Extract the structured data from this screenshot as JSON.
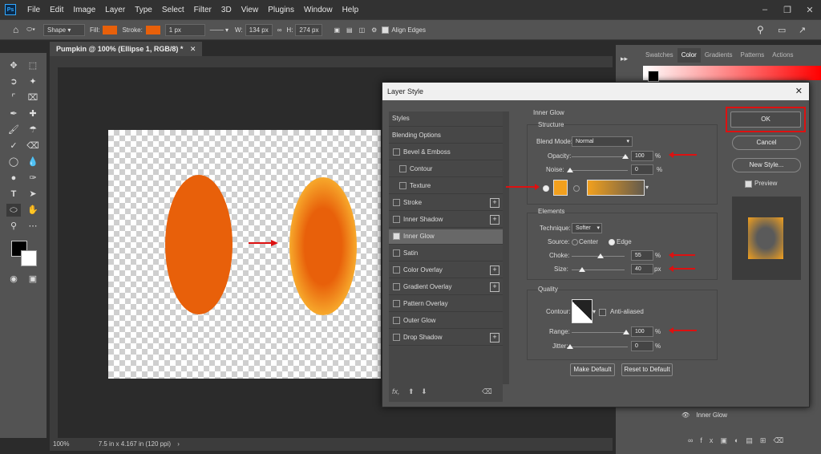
{
  "app": {
    "logo": "Ps"
  },
  "menu": [
    "File",
    "Edit",
    "Image",
    "Layer",
    "Type",
    "Select",
    "Filter",
    "3D",
    "View",
    "Plugins",
    "Window",
    "Help"
  ],
  "options": {
    "mode": "Shape",
    "fill_label": "Fill:",
    "stroke_label": "Stroke:",
    "stroke_width": "1 px",
    "w_label": "W:",
    "w_value": "134 px",
    "h_label": "H:",
    "h_value": "274 px",
    "align_edges": "Align Edges",
    "fill_color": "#e8600a"
  },
  "document": {
    "tab": "Pumpkin @ 100% (Ellipse 1, RGB/8) *",
    "zoom": "100%",
    "size": "7.5 in x 4.167 in (120 ppi)"
  },
  "panels": {
    "tabs": [
      "Swatches",
      "Color",
      "Gradients",
      "Patterns",
      "Actions"
    ],
    "active": "Color",
    "layer_effect": "Inner Glow"
  },
  "dialog": {
    "title": "Layer Style",
    "styles_header": "Styles",
    "items": [
      {
        "label": "Blending Options"
      },
      {
        "label": "Bevel & Emboss"
      },
      {
        "label": "Contour"
      },
      {
        "label": "Texture"
      },
      {
        "label": "Stroke"
      },
      {
        "label": "Inner Shadow"
      },
      {
        "label": "Inner Glow"
      },
      {
        "label": "Satin"
      },
      {
        "label": "Color Overlay"
      },
      {
        "label": "Gradient Overlay"
      },
      {
        "label": "Pattern Overlay"
      },
      {
        "label": "Outer Glow"
      },
      {
        "label": "Drop Shadow"
      }
    ],
    "fx_label": "fx,",
    "section_title": "Inner Glow",
    "structure": {
      "title": "Structure",
      "blend_mode_label": "Blend Mode:",
      "blend_mode": "Normal",
      "opacity_label": "Opacity:",
      "opacity": "100",
      "noise_label": "Noise:",
      "noise": "0",
      "pct": "%"
    },
    "glow_color": "#f2a01e",
    "elements": {
      "title": "Elements",
      "technique_label": "Technique:",
      "technique": "Softer",
      "source_label": "Source:",
      "center": "Center",
      "edge": "Edge",
      "choke_label": "Choke:",
      "choke": "55",
      "size_label": "Size:",
      "size": "40",
      "px": "px"
    },
    "quality": {
      "title": "Quality",
      "contour_label": "Contour:",
      "anti_aliased": "Anti-aliased",
      "range_label": "Range:",
      "range": "100",
      "jitter_label": "Jitter:",
      "jitter": "0"
    },
    "make_default": "Make Default",
    "reset_default": "Reset to Default",
    "ok": "OK",
    "cancel": "Cancel",
    "new_style": "New Style...",
    "preview": "Preview"
  }
}
